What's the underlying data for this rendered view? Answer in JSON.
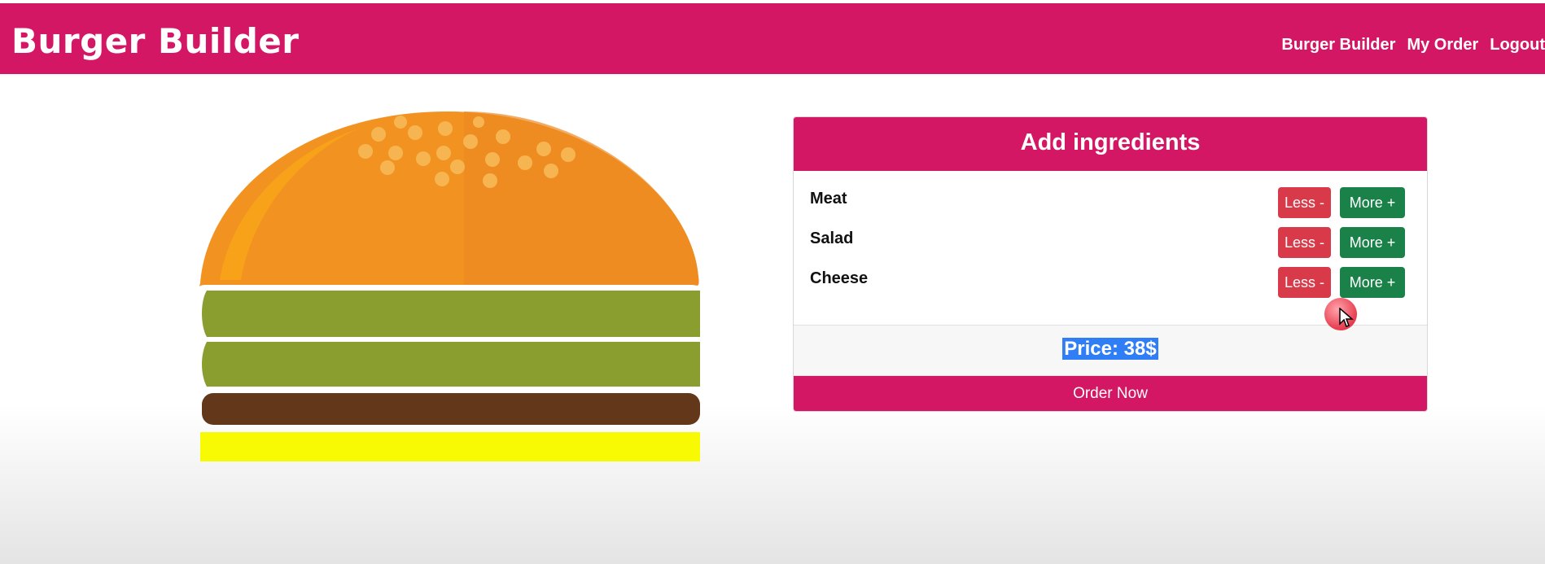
{
  "navbar": {
    "brand": "Burger Builder",
    "links": [
      "Burger Builder",
      "My Order",
      "Logout"
    ]
  },
  "panel": {
    "title": "Add ingredients",
    "ingredients": [
      {
        "label": "Meat",
        "less": "Less -",
        "more": "More +"
      },
      {
        "label": "Salad",
        "less": "Less -",
        "more": "More +"
      },
      {
        "label": "Cheese",
        "less": "Less -",
        "more": "More +"
      }
    ],
    "price": "Price: 38$",
    "order_button": "Order Now"
  },
  "burger": {
    "layers": [
      "bread-top",
      "salad",
      "salad",
      "meat",
      "cheese"
    ]
  },
  "colors": {
    "brand": "#d41764",
    "less_button": "#d83a49",
    "more_button": "#1a8249",
    "bun": "#f29220",
    "salad": "#8a9d2f",
    "meat": "#63381a",
    "cheese": "#f8fa04",
    "selection": "#2f7ef5"
  },
  "icons": [
    "cursor-icon"
  ]
}
